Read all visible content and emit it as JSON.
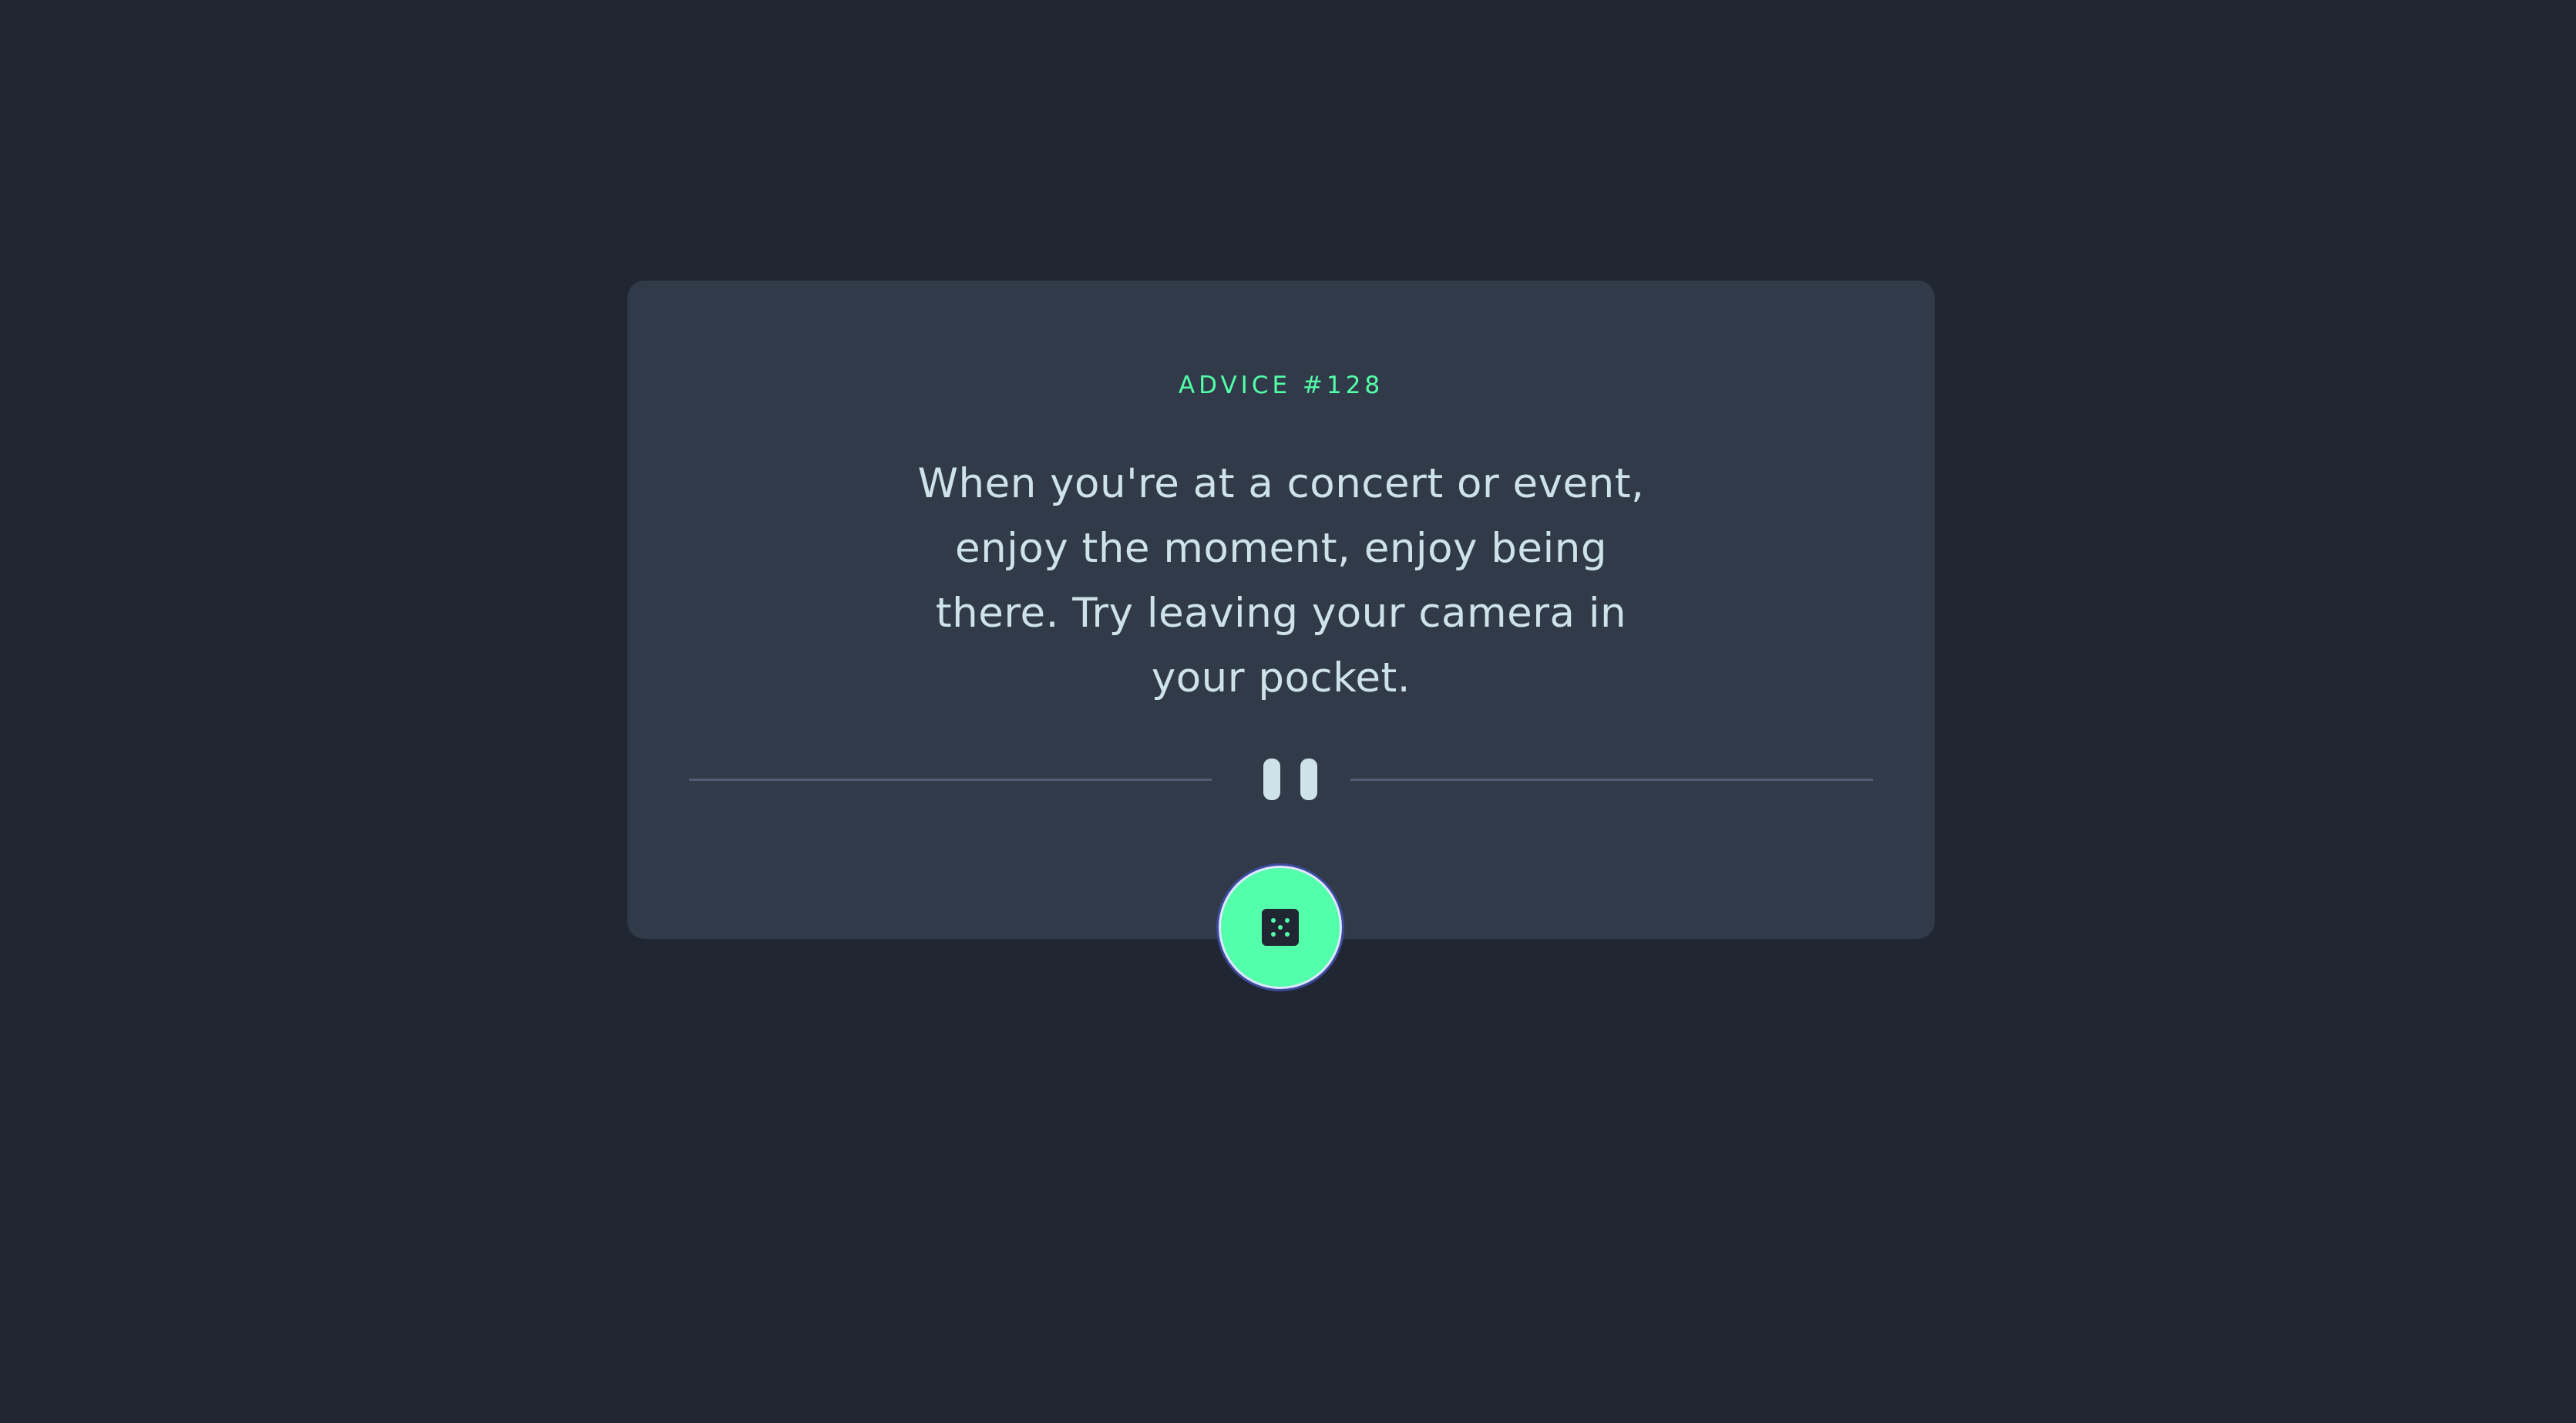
{
  "advice": {
    "label": "ADVICE #128",
    "text": "When you're at a concert or event, enjoy the moment, enjoy being there. Try leaving your camera in your pocket."
  },
  "divider": {
    "icon": "pause-icon"
  },
  "button": {
    "icon": "dice-icon",
    "action": "generate new advice"
  },
  "colors": {
    "background": "#202632",
    "card": "#313a48",
    "accent": "#53ffaa",
    "text": "#cee3e9",
    "divider": "#4f5d74"
  }
}
